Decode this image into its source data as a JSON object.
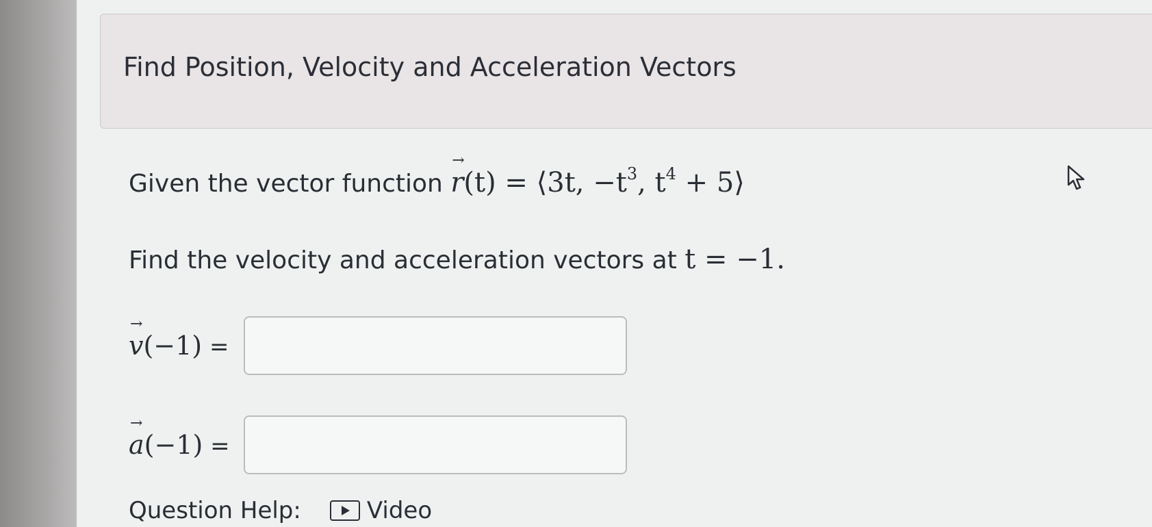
{
  "title": "Find Position, Velocity and Acceleration Vectors",
  "given": {
    "prefix": "Given the vector function",
    "fn_var": "r",
    "fn_arg": "(t)",
    "equals": " = ",
    "vector": {
      "open": "⟨",
      "c1": "3t, ",
      "c2_base": "−t",
      "c2_exp": "3",
      "c2_sep": ", ",
      "c3_base": "t",
      "c3_exp": "4",
      "c3_rest": " + 5",
      "close": "⟩"
    }
  },
  "task": {
    "text": "Find the velocity and acceleration vectors at",
    "condition": "t = −1."
  },
  "velocity": {
    "var": "v",
    "arg": "(−1)",
    "eq": " =",
    "value": ""
  },
  "acceleration": {
    "var": "a",
    "arg": "(−1)",
    "eq": " =",
    "value": ""
  },
  "help": {
    "label": "Question Help:",
    "video_label": "Video"
  },
  "icons": {
    "video": "play-icon",
    "pointer": "mouse-cursor-icon"
  }
}
